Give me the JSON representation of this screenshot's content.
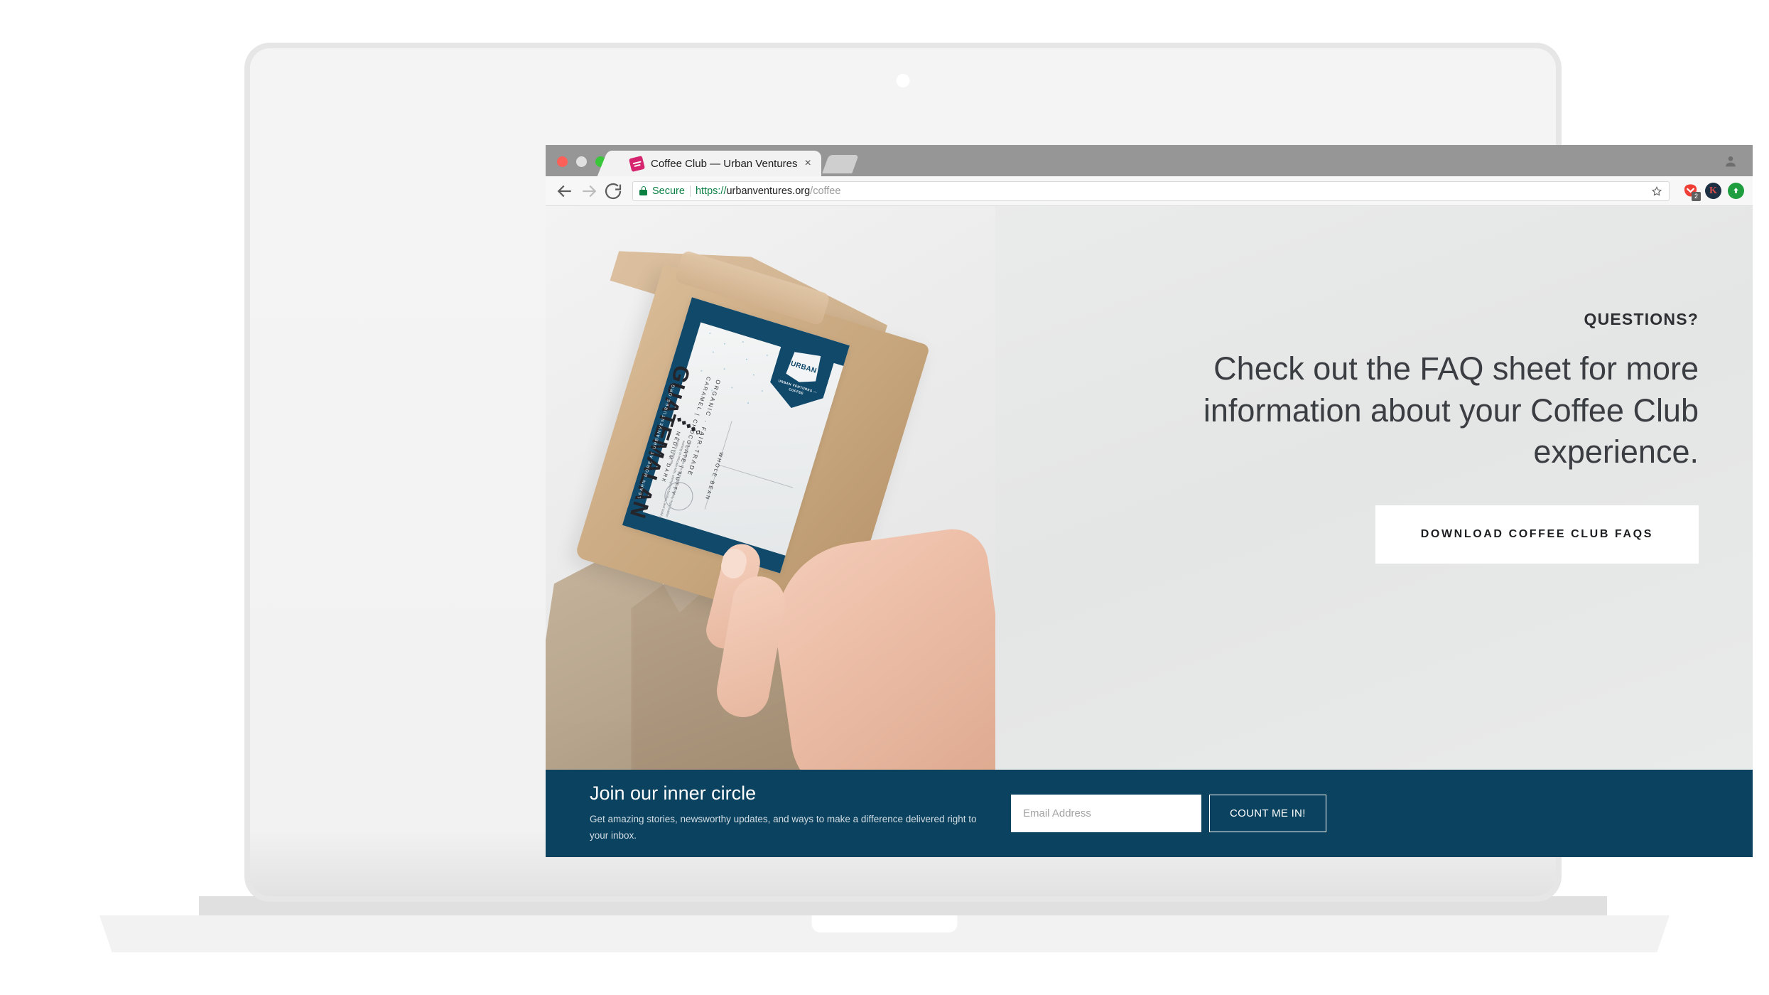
{
  "browser": {
    "window_controls": [
      "close",
      "minimize",
      "maximize"
    ],
    "tab": {
      "title": "Coffee Club — Urban Ventures",
      "favicon_name": "urban-ventures-favicon",
      "close_label": "×"
    },
    "new_tab_label": "",
    "profile_icon": "account-icon",
    "nav": {
      "back": "←",
      "forward": "→",
      "reload": "⟳"
    },
    "omnibox": {
      "security_label": "Secure",
      "url_scheme": "https://",
      "url_host": "urbanventures.org",
      "url_path": "/coffee",
      "bookmark_icon": "star-icon"
    },
    "extensions": [
      {
        "name": "pocket-extension",
        "badge": "2"
      },
      {
        "name": "kindle-extension",
        "glyph": "K"
      },
      {
        "name": "upload-extension",
        "glyph": "⬆"
      }
    ]
  },
  "hero": {
    "eyebrow": "QUESTIONS?",
    "headline": "Check out the FAQ sheet for more information about your Coffee Club experience.",
    "cta_label": "DOWNLOAD COFFEE CLUB FAQS",
    "photo_alt": "hand-holding-coffee-bag"
  },
  "product_label": {
    "brand_badge": "URBAN",
    "brand_badge_sub": "VENTURES",
    "brand_line": "URBAN VENTURES — COFFEE",
    "organic": "ORGANIC · FAIR-TRADE",
    "origin": "GUATEMALAN",
    "tasting_notes": "CARAMEL | CHOCOLATE | NUTTY",
    "roast": "MEDIUM DARK",
    "grind_line_1": "WHOLE BEAN",
    "grind_line_2": "COFFEE",
    "body_copy": "Urban Ventures is a 501(c)(3) community organization working to educate kids, strengthen families, and build a healthy community.",
    "learn_more": "LEARN MORE AT URBANVENTURES.ORG"
  },
  "signup": {
    "title": "Join our inner circle",
    "subtitle": "Get amazing stories, newsworthy updates, and ways to make a difference delivered right to your inbox.",
    "email_placeholder": "Email Address",
    "email_value": "",
    "submit_label": "COUNT ME IN!"
  },
  "colors": {
    "navy": "#0a4260",
    "hero_bg": "#e6e7e7",
    "cta_bg": "#ffffff",
    "secure_green": "#0b8043",
    "favicon_pink": "#d6246e"
  }
}
